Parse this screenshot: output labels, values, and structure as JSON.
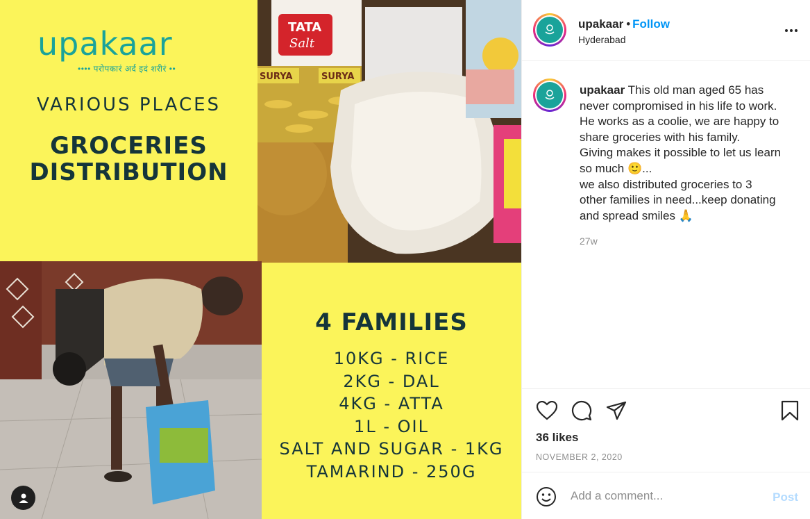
{
  "image": {
    "logo": {
      "name": "upakaar",
      "tagline": "•••• परोपकारं अर्द इदं शरीरं ••"
    },
    "left_title": {
      "subtitle": "VARIOUS PLACES",
      "line1": "GROCERIES",
      "line2": "DISTRIBUTION"
    },
    "right_panel": {
      "heading": "4 FAMILIES",
      "items": [
        "10KG - RICE",
        "2KG - DAL",
        "4KG - ATTA",
        "1L - OIL",
        "SALT AND SUGAR - 1KG",
        "TAMARIND - 250G"
      ]
    },
    "photo_labels": {
      "salt_brand": "TATA",
      "salt_word": "Salt",
      "turmeric_brand": "SURYA"
    }
  },
  "header": {
    "username": "upakaar",
    "separator": "•",
    "follow_label": "Follow",
    "location": "Hyderabad",
    "more_icon": "more-horizontal-icon"
  },
  "caption": {
    "username": "upakaar",
    "lines": [
      "This old man aged 65 has",
      "never compromised in his life to work.",
      "He works as a coolie, we are happy to",
      "share groceries with his family.",
      "Giving makes it possible to let us learn",
      "so much 🙂...",
      "we also distributed groceries to 3",
      "other families in need...keep donating",
      "and spread smiles 🙏"
    ],
    "first_line_text": "This old man aged 65 has",
    "time": "27w"
  },
  "actions": {
    "like_icon": "heart-icon",
    "comment_icon": "comment-icon",
    "share_icon": "share-icon",
    "save_icon": "bookmark-icon"
  },
  "likes": "36 likes",
  "date": "NOVEMBER 2, 2020",
  "comment": {
    "placeholder": "Add a comment...",
    "post_label": "Post",
    "emoji_icon": "emoji-icon"
  },
  "colors": {
    "accent": "#0095f6",
    "poster_yellow": "#fbf45a",
    "poster_text": "#15353a",
    "brand_teal": "#1aa39a"
  }
}
